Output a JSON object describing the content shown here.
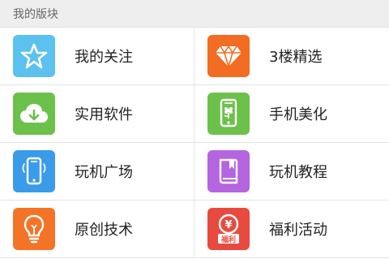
{
  "section": {
    "title": "我的版块"
  },
  "tiles": [
    {
      "label": "我的关注",
      "icon": "star-icon",
      "color": "#5bc1ee"
    },
    {
      "label": "3楼精选",
      "icon": "diamond-icon",
      "color": "#f36c23"
    },
    {
      "label": "实用软件",
      "icon": "cloud-download-icon",
      "color": "#6cc14a"
    },
    {
      "label": "手机美化",
      "icon": "phone-flower-icon",
      "color": "#6cc14a"
    },
    {
      "label": "玩机广场",
      "icon": "phone-icon",
      "color": "#3a9be8"
    },
    {
      "label": "玩机教程",
      "icon": "book-icon",
      "color": "#b565e0"
    },
    {
      "label": "原创技术",
      "icon": "lightbulb-icon",
      "color": "#f37427"
    },
    {
      "label": "福利活动",
      "icon": "welfare-coin-icon",
      "color": "#e84a3f"
    }
  ],
  "welfare_icon_text": "福利",
  "welfare_icon_symbol": "¥"
}
